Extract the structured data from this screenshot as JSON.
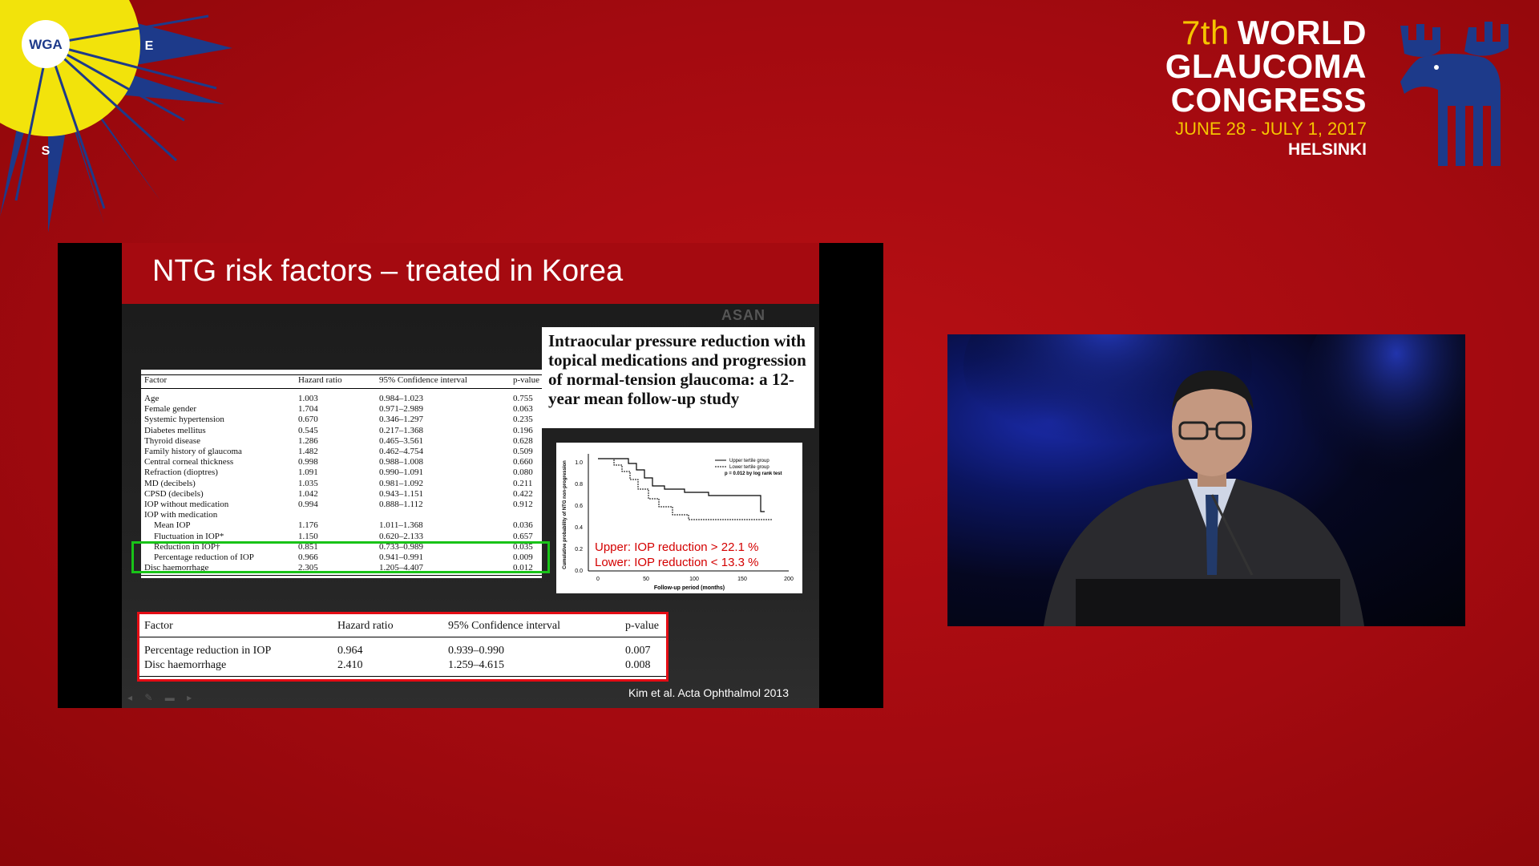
{
  "logo": {
    "initials": "WGA",
    "compass_e": "E",
    "compass_s": "S",
    "colors": {
      "sun": "#f2e30b",
      "rays": "#1d3a8a"
    }
  },
  "congress": {
    "ordinal": "7th",
    "line1": "WORLD",
    "line2": "GLAUCOMA",
    "line3": "CONGRESS",
    "dates": "JUNE 28 - JULY 1, 2017",
    "city": "HELSINKI",
    "mascot_icon": "moose-icon"
  },
  "slide": {
    "title": "NTG risk factors – treated in Korea",
    "watermark": "ASAN",
    "table1": {
      "headers": [
        "Factor",
        "Hazard ratio",
        "95% Confidence interval",
        "p-value"
      ],
      "rows": [
        [
          "Age",
          "1.003",
          "0.984–1.023",
          "0.755"
        ],
        [
          "Female gender",
          "1.704",
          "0.971–2.989",
          "0.063"
        ],
        [
          "Systemic hypertension",
          "0.670",
          "0.346–1.297",
          "0.235"
        ],
        [
          "Diabetes mellitus",
          "0.545",
          "0.217–1.368",
          "0.196"
        ],
        [
          "Thyroid disease",
          "1.286",
          "0.465–3.561",
          "0.628"
        ],
        [
          "Family history of glaucoma",
          "1.482",
          "0.462–4.754",
          "0.509"
        ],
        [
          "Central corneal thickness",
          "0.998",
          "0.988–1.008",
          "0.660"
        ],
        [
          "Refraction (dioptres)",
          "1.091",
          "0.990–1.091",
          "0.080"
        ],
        [
          "MD (decibels)",
          "1.035",
          "0.981–1.092",
          "0.211"
        ],
        [
          "CPSD (decibels)",
          "1.042",
          "0.943–1.151",
          "0.422"
        ],
        [
          "IOP without medication",
          "0.994",
          "0.888–1.112",
          "0.912"
        ],
        [
          "IOP with medication",
          "",
          "",
          ""
        ],
        [
          "Mean IOP",
          "1.176",
          "1.011–1.368",
          "0.036"
        ],
        [
          "Fluctuation in IOP*",
          "1.150",
          "0.620–2.133",
          "0.657"
        ],
        [
          "Reduction in IOP†",
          "0.851",
          "0.733–0.989",
          "0.035"
        ],
        [
          "Percentage reduction of IOP",
          "0.966",
          "0.941–0.991",
          "0.009"
        ],
        [
          "Disc haemorrhage",
          "2.305",
          "1.205–4.407",
          "0.012"
        ]
      ]
    },
    "paper_title": "Intraocular pressure reduction with topical medications and progression of normal-tension glaucoma: a 12-year mean follow-up study",
    "km_plot": {
      "ylabel": "Cumulative probability of NTG non-progression",
      "xlabel": "Follow-up period (months)",
      "x_ticks": [
        "0",
        "50",
        "100",
        "150",
        "200"
      ],
      "y_ticks": [
        "0.0",
        "0.2",
        "0.4",
        "0.6",
        "0.8",
        "1.0"
      ],
      "legend": [
        "Upper tertile group",
        "Lower tertile group"
      ],
      "pvalue_note": "p = 0.012 by log rank test",
      "note_upper": "Upper: IOP reduction > 22.1 %",
      "note_lower": "Lower: IOP reduction < 13.3 %",
      "colors": {
        "note": "#d40000"
      }
    },
    "table2": {
      "headers": [
        "Factor",
        "Hazard ratio",
        "95% Confidence interval",
        "p-value"
      ],
      "rows": [
        [
          "Percentage reduction in IOP",
          "0.964",
          "0.939–0.990",
          "0.007"
        ],
        [
          "Disc haemorrhage",
          "2.410",
          "1.259–4.615",
          "0.008"
        ]
      ]
    },
    "citation": "Kim et al. Acta Ophthalmol 2013",
    "colors": {
      "header": "#a50a10",
      "highlight_green": "#19c318",
      "highlight_red": "#e40c14"
    }
  },
  "video": {
    "subject": "speaker-at-podium"
  }
}
